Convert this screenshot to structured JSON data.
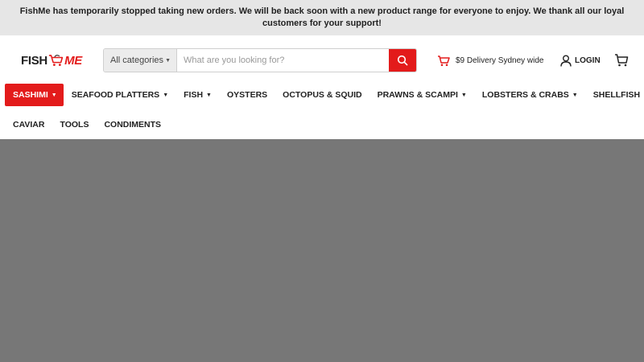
{
  "announcement": {
    "text": "FishMe has temporarily stopped taking new orders. We will be back soon with a new product range for everyone to enjoy. We thank all our loyal customers for your support!"
  },
  "logo": {
    "left_text": "FISH",
    "right_text": "ME",
    "icon": "shopping-cart-icon",
    "brand_color": "#e31b1b"
  },
  "search": {
    "category_label": "All categories",
    "placeholder": "What are you looking for?",
    "value": "",
    "button_icon": "search-icon"
  },
  "delivery": {
    "text": "$9 Delivery Sydney wide",
    "icon": "delivery-cart-icon"
  },
  "account": {
    "login_label": "LOGIN",
    "login_icon": "user-icon",
    "cart_icon": "cart-icon"
  },
  "nav": {
    "row1": [
      {
        "label": "SASHIMI",
        "dropdown": true,
        "active": true
      },
      {
        "label": "SEAFOOD PLATTERS",
        "dropdown": true
      },
      {
        "label": "FISH",
        "dropdown": true
      },
      {
        "label": "OYSTERS",
        "dropdown": false
      },
      {
        "label": "OCTOPUS & SQUID",
        "dropdown": false
      },
      {
        "label": "PRAWNS & SCAMPI",
        "dropdown": true
      },
      {
        "label": "LOBSTERS & CRABS",
        "dropdown": true
      },
      {
        "label": "SHELLFISH",
        "dropdown": false
      }
    ],
    "row2": [
      {
        "label": "CAVIAR",
        "dropdown": false
      },
      {
        "label": "TOOLS",
        "dropdown": false
      },
      {
        "label": "CONDIMENTS",
        "dropdown": false
      }
    ],
    "active_color": "#e31b1b"
  },
  "overlay_color": "#777777"
}
